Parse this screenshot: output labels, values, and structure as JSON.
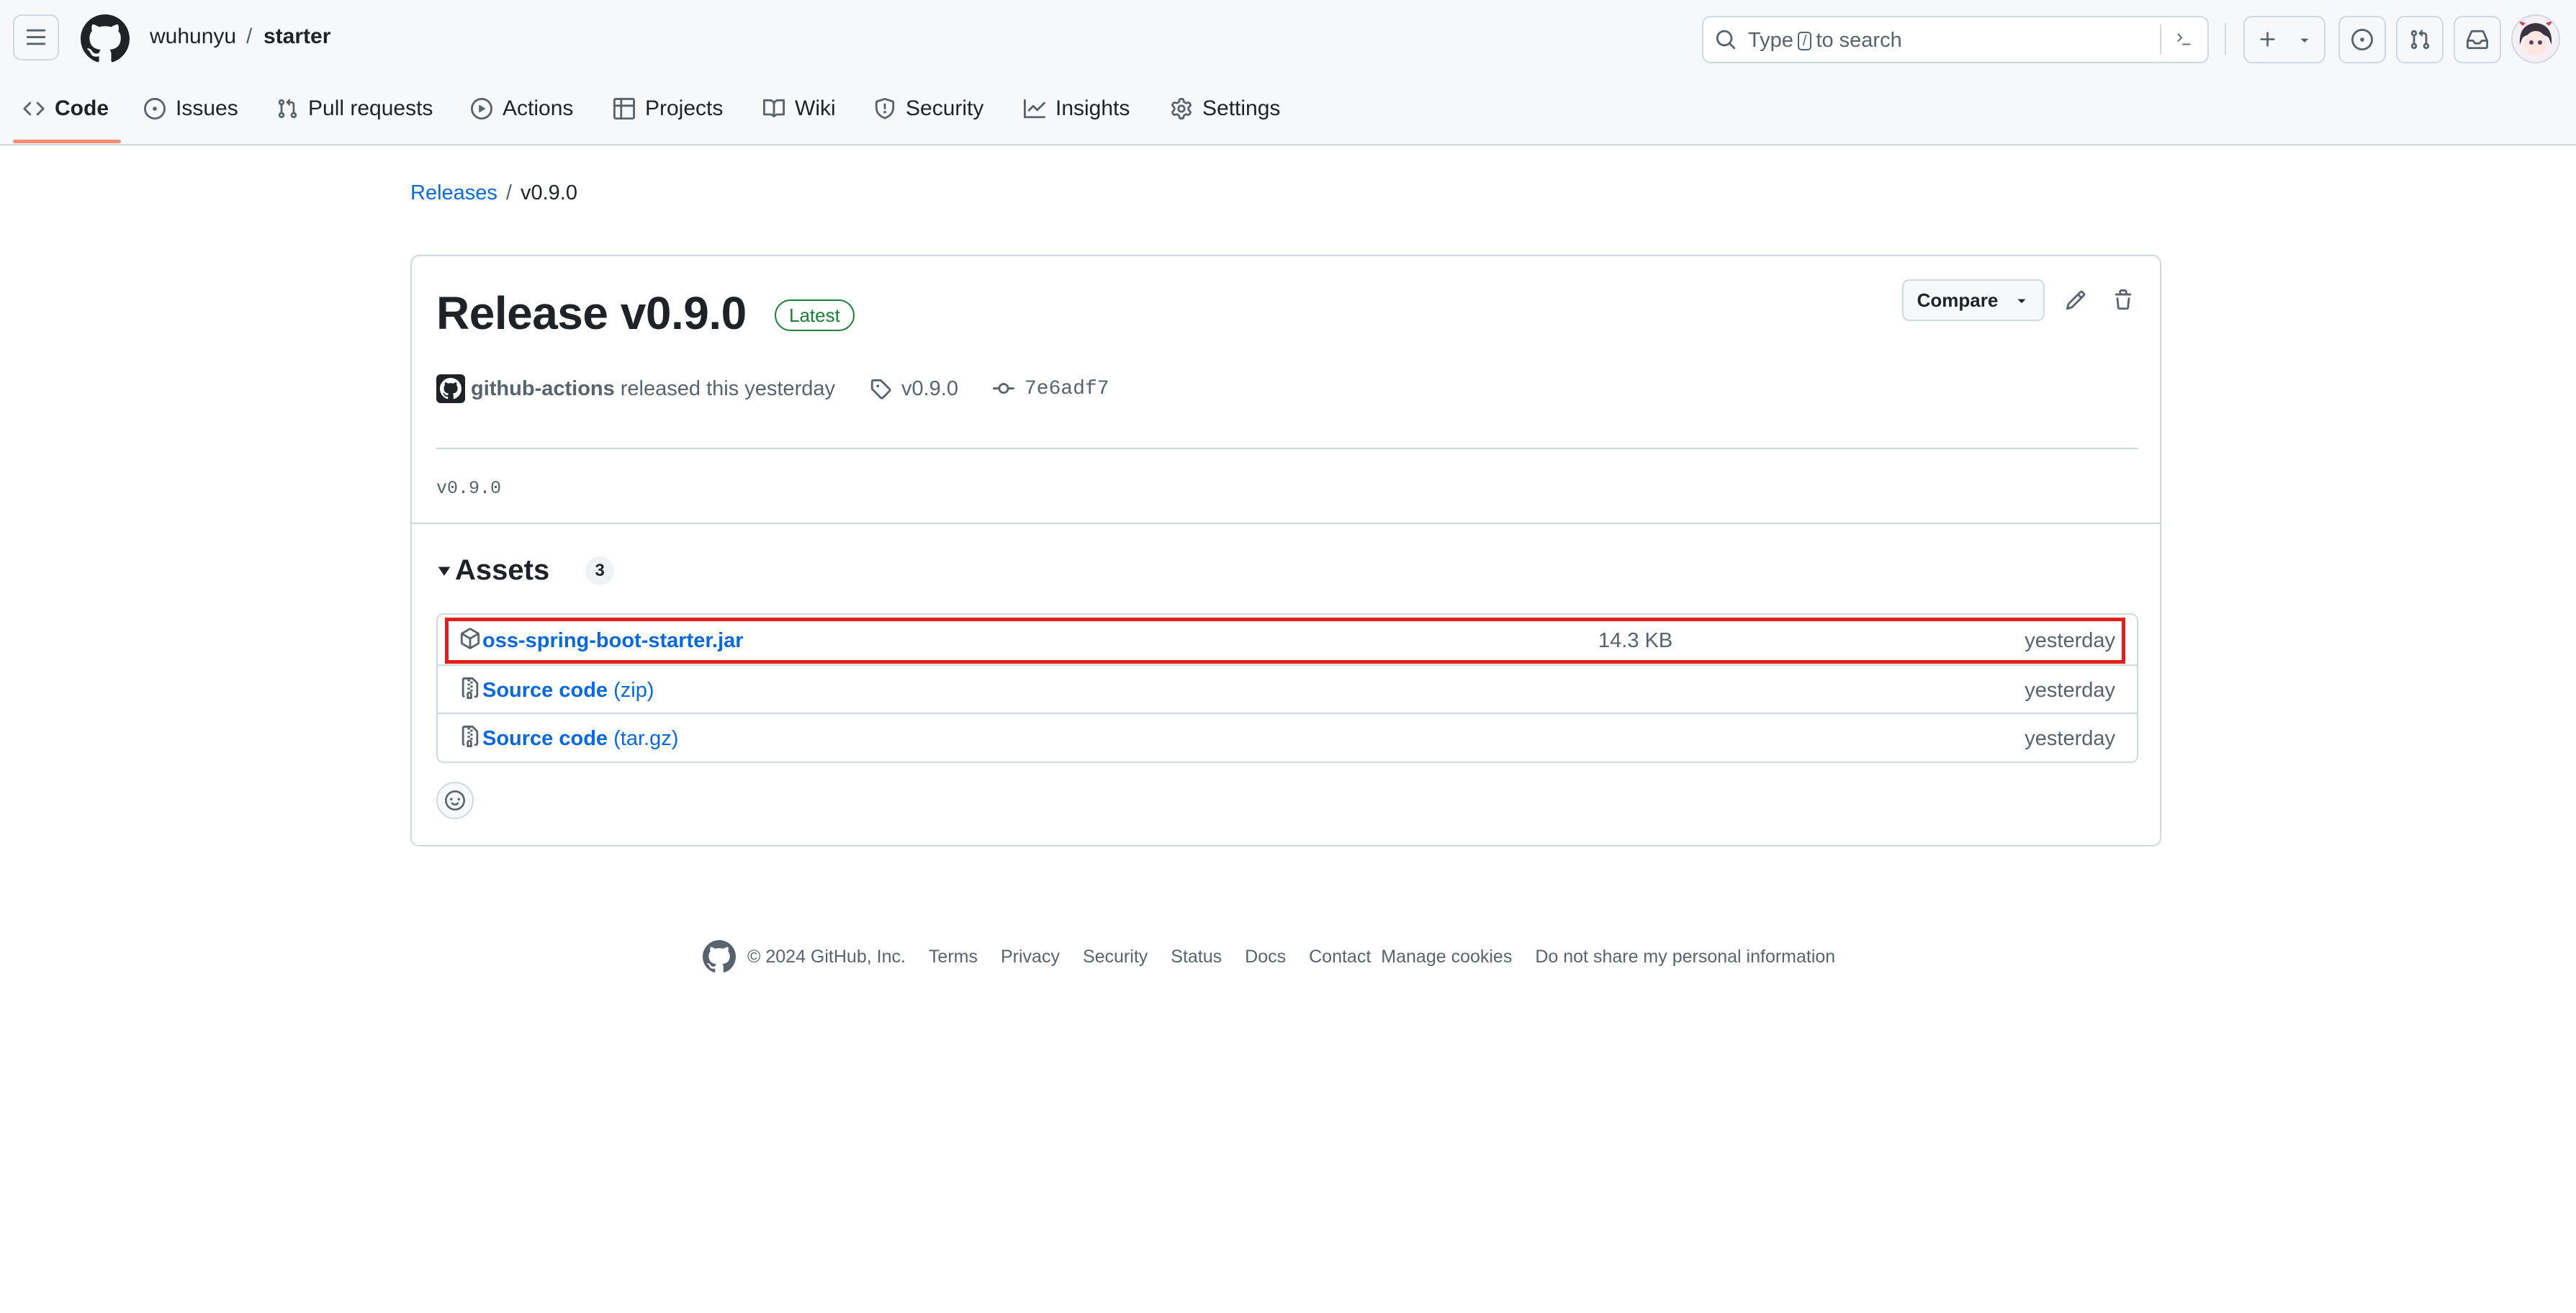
{
  "header": {
    "owner": "wuhunyu",
    "separator": "/",
    "repo": "starter",
    "search": {
      "prefix": "Type",
      "key": "/",
      "suffix": "to search"
    }
  },
  "repo_nav": {
    "tabs": [
      {
        "label": "Code",
        "icon": "code-icon",
        "active": true
      },
      {
        "label": "Issues",
        "icon": "issue-opened-icon"
      },
      {
        "label": "Pull requests",
        "icon": "git-pull-request-icon"
      },
      {
        "label": "Actions",
        "icon": "play-icon"
      },
      {
        "label": "Projects",
        "icon": "table-icon"
      },
      {
        "label": "Wiki",
        "icon": "book-icon"
      },
      {
        "label": "Security",
        "icon": "shield-icon"
      },
      {
        "label": "Insights",
        "icon": "graph-icon"
      },
      {
        "label": "Settings",
        "icon": "gear-icon"
      }
    ]
  },
  "breadcrumb": {
    "parent": "Releases",
    "separator": "/",
    "current": "v0.9.0"
  },
  "release": {
    "title": "Release v0.9.0",
    "badge": "Latest",
    "compare_label": "Compare",
    "author": "github-actions",
    "released_text": "released this yesterday",
    "tag": "v0.9.0",
    "commit": "7e6adf7",
    "body": "v0.9.0"
  },
  "assets": {
    "title": "Assets",
    "count": "3",
    "items": [
      {
        "name": "oss-spring-boot-starter.jar",
        "ext": "",
        "size": "14.3 KB",
        "date": "yesterday",
        "icon": "package-icon"
      },
      {
        "name": "Source code",
        "ext": "(zip)",
        "size": "",
        "date": "yesterday",
        "icon": "file-zip-icon"
      },
      {
        "name": "Source code",
        "ext": "(tar.gz)",
        "size": "",
        "date": "yesterday",
        "icon": "file-zip-icon"
      }
    ]
  },
  "footer": {
    "copyright": "© 2024 GitHub, Inc.",
    "links": [
      "Terms",
      "Privacy",
      "Security",
      "Status",
      "Docs",
      "Contact",
      "Manage cookies",
      "Do not share my personal information"
    ]
  },
  "colors": {
    "accent": "#0969da",
    "latest": "#1a7f37",
    "tab_underline": "#fd8c73",
    "highlight": "#e0201b"
  }
}
